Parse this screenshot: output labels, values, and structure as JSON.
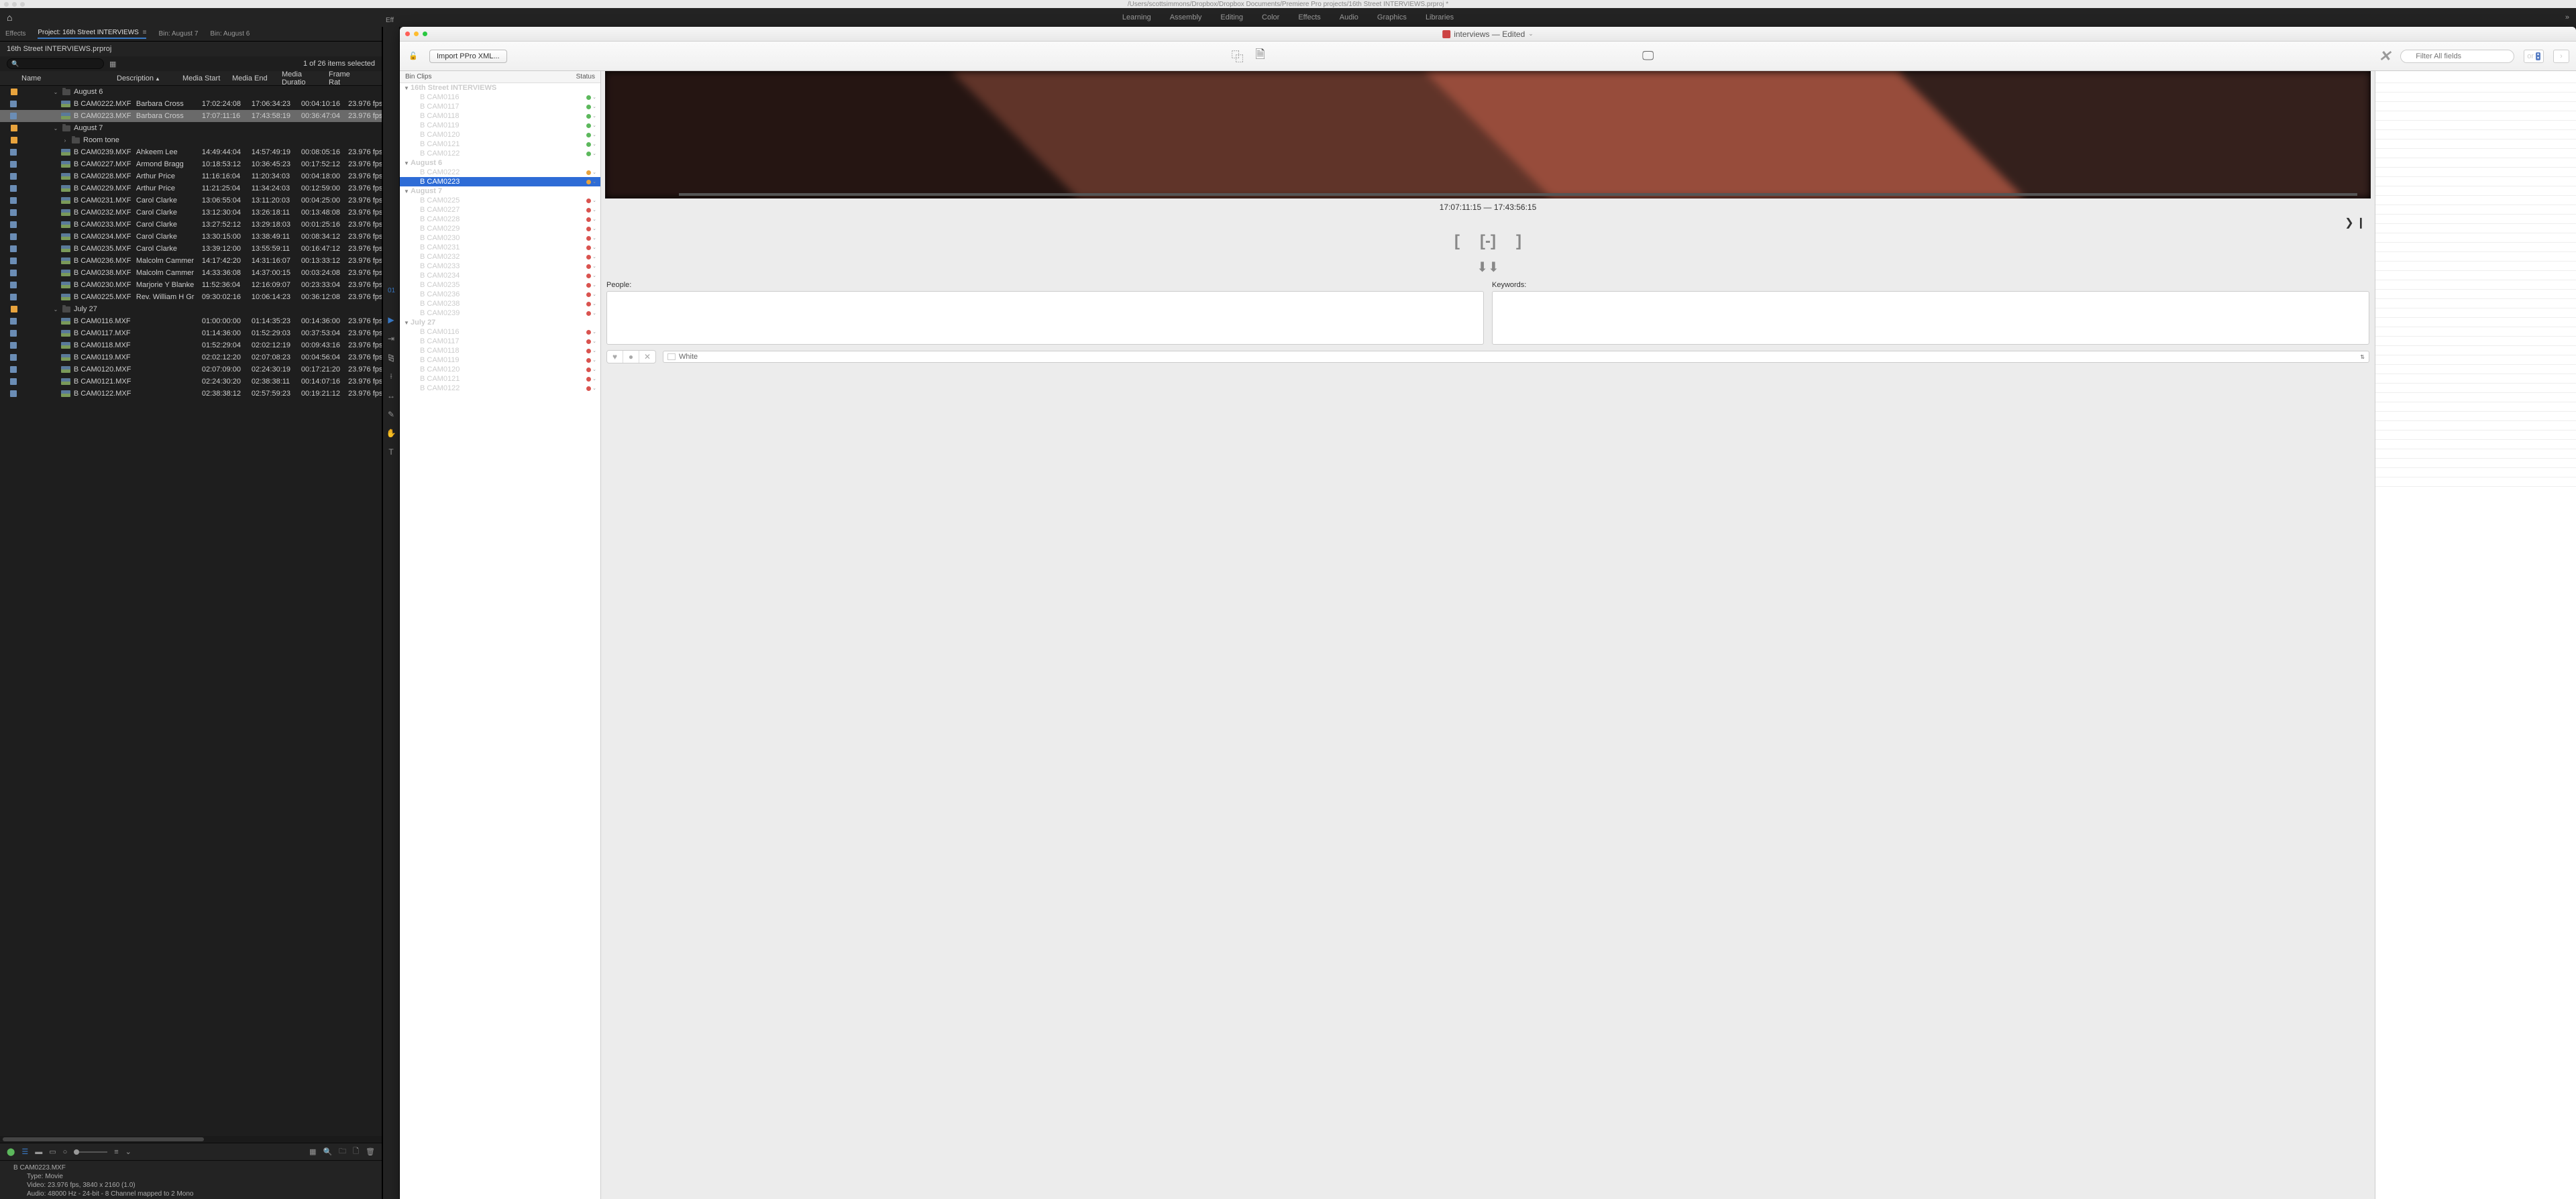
{
  "mac_title": "/Users/scottsimmons/Dropbox/Dropbox Documents/Premiere Pro projects/16th Street INTERVIEWS.prproj *",
  "workspaces": [
    "Learning",
    "Assembly",
    "Editing",
    "Color",
    "Effects",
    "Audio",
    "Graphics",
    "Libraries"
  ],
  "panel_tabs": {
    "effects": "Effects",
    "project": "Project: 16th Street INTERVIEWS",
    "bin1": "Bin: August 7",
    "bin2": "Bin: August 6"
  },
  "project_title": "16th Street INTERVIEWS.prproj",
  "item_count": "1 of 26 items selected",
  "columns": {
    "name": "Name",
    "desc": "Description",
    "start": "Media Start",
    "end": "Media End",
    "dur": "Media Duratio",
    "fps": "Frame Rat"
  },
  "folders": {
    "aug6": "August 6",
    "aug7": "August 7",
    "roomtone": "Room tone",
    "jul27": "July 27"
  },
  "rows": [
    {
      "g": "aug6",
      "name": "B CAM0222.MXF",
      "desc": "Barbara Cross",
      "start": "17:02:24:08",
      "end": "17:06:34:23",
      "dur": "00:04:10:16",
      "fps": "23.976 fps"
    },
    {
      "g": "aug6",
      "name": "B CAM0223.MXF",
      "desc": "Barbara Cross",
      "start": "17:07:11:16",
      "end": "17:43:58:19",
      "dur": "00:36:47:04",
      "fps": "23.976 fps",
      "sel": true
    },
    {
      "g": "aug7",
      "name": "B CAM0239.MXF",
      "desc": "Ahkeem Lee",
      "start": "14:49:44:04",
      "end": "14:57:49:19",
      "dur": "00:08:05:16",
      "fps": "23.976 fps"
    },
    {
      "g": "aug7",
      "name": "B CAM0227.MXF",
      "desc": "Armond Bragg",
      "start": "10:18:53:12",
      "end": "10:36:45:23",
      "dur": "00:17:52:12",
      "fps": "23.976 fps"
    },
    {
      "g": "aug7",
      "name": "B CAM0228.MXF",
      "desc": "Arthur Price",
      "start": "11:16:16:04",
      "end": "11:20:34:03",
      "dur": "00:04:18:00",
      "fps": "23.976 fps"
    },
    {
      "g": "aug7",
      "name": "B CAM0229.MXF",
      "desc": "Arthur Price",
      "start": "11:21:25:04",
      "end": "11:34:24:03",
      "dur": "00:12:59:00",
      "fps": "23.976 fps"
    },
    {
      "g": "aug7",
      "name": "B CAM0231.MXF",
      "desc": "Carol Clarke",
      "start": "13:06:55:04",
      "end": "13:11:20:03",
      "dur": "00:04:25:00",
      "fps": "23.976 fps"
    },
    {
      "g": "aug7",
      "name": "B CAM0232.MXF",
      "desc": "Carol Clarke",
      "start": "13:12:30:04",
      "end": "13:26:18:11",
      "dur": "00:13:48:08",
      "fps": "23.976 fps"
    },
    {
      "g": "aug7",
      "name": "B CAM0233.MXF",
      "desc": "Carol Clarke",
      "start": "13:27:52:12",
      "end": "13:29:18:03",
      "dur": "00:01:25:16",
      "fps": "23.976 fps"
    },
    {
      "g": "aug7",
      "name": "B CAM0234.MXF",
      "desc": "Carol Clarke",
      "start": "13:30:15:00",
      "end": "13:38:49:11",
      "dur": "00:08:34:12",
      "fps": "23.976 fps"
    },
    {
      "g": "aug7",
      "name": "B CAM0235.MXF",
      "desc": "Carol Clarke",
      "start": "13:39:12:00",
      "end": "13:55:59:11",
      "dur": "00:16:47:12",
      "fps": "23.976 fps"
    },
    {
      "g": "aug7",
      "name": "B CAM0236.MXF",
      "desc": "Malcolm Cammer",
      "start": "14:17:42:20",
      "end": "14:31:16:07",
      "dur": "00:13:33:12",
      "fps": "23.976 fps"
    },
    {
      "g": "aug7",
      "name": "B CAM0238.MXF",
      "desc": "Malcolm Cammer",
      "start": "14:33:36:08",
      "end": "14:37:00:15",
      "dur": "00:03:24:08",
      "fps": "23.976 fps"
    },
    {
      "g": "aug7",
      "name": "B CAM0230.MXF",
      "desc": "Marjorie Y Blanke",
      "start": "11:52:36:04",
      "end": "12:16:09:07",
      "dur": "00:23:33:04",
      "fps": "23.976 fps"
    },
    {
      "g": "aug7",
      "name": "B CAM0225.MXF",
      "desc": "Rev. William H Gr",
      "start": "09:30:02:16",
      "end": "10:06:14:23",
      "dur": "00:36:12:08",
      "fps": "23.976 fps"
    },
    {
      "g": "jul27",
      "name": "B CAM0116.MXF",
      "desc": "",
      "start": "01:00:00:00",
      "end": "01:14:35:23",
      "dur": "00:14:36:00",
      "fps": "23.976 fps"
    },
    {
      "g": "jul27",
      "name": "B CAM0117.MXF",
      "desc": "",
      "start": "01:14:36:00",
      "end": "01:52:29:03",
      "dur": "00:37:53:04",
      "fps": "23.976 fps"
    },
    {
      "g": "jul27",
      "name": "B CAM0118.MXF",
      "desc": "",
      "start": "01:52:29:04",
      "end": "02:02:12:19",
      "dur": "00:09:43:16",
      "fps": "23.976 fps"
    },
    {
      "g": "jul27",
      "name": "B CAM0119.MXF",
      "desc": "",
      "start": "02:02:12:20",
      "end": "02:07:08:23",
      "dur": "00:04:56:04",
      "fps": "23.976 fps"
    },
    {
      "g": "jul27",
      "name": "B CAM0120.MXF",
      "desc": "",
      "start": "02:07:09:00",
      "end": "02:24:30:19",
      "dur": "00:17:21:20",
      "fps": "23.976 fps"
    },
    {
      "g": "jul27",
      "name": "B CAM0121.MXF",
      "desc": "",
      "start": "02:24:30:20",
      "end": "02:38:38:11",
      "dur": "00:14:07:16",
      "fps": "23.976 fps"
    },
    {
      "g": "jul27",
      "name": "B CAM0122.MXF",
      "desc": "",
      "start": "02:38:38:12",
      "end": "02:57:59:23",
      "dur": "00:19:21:12",
      "fps": "23.976 fps"
    }
  ],
  "info": {
    "name": "B CAM0223.MXF",
    "type": "Type:  Movie",
    "video": "Video:  23.976 fps, 3840 x 2160 (1.0)",
    "audio": "Audio:  48000 Hz - 24-bit - 8 Channel mapped to 2 Mono"
  },
  "float": {
    "title": "interviews — Edited",
    "import_btn": "Import PPro XML...",
    "bin_header": "Bin Clips",
    "status_header": "Status",
    "filter_placeholder": "Filter All fields",
    "or_label": "or",
    "timecode": "17:07:11:15 — 17:43:56:15",
    "people_label": "People:",
    "keywords_label": "Keywords:",
    "color_label": "White",
    "tree": [
      {
        "label": "16th Street INTERVIEWS",
        "depth": 0,
        "bold": true,
        "twirl": true
      },
      {
        "label": "B CAM0116",
        "depth": 1,
        "status": "green"
      },
      {
        "label": "B CAM0117",
        "depth": 1,
        "status": "green"
      },
      {
        "label": "B CAM0118",
        "depth": 1,
        "status": "green"
      },
      {
        "label": "B CAM0119",
        "depth": 1,
        "status": "green"
      },
      {
        "label": "B CAM0120",
        "depth": 1,
        "status": "green"
      },
      {
        "label": "B CAM0121",
        "depth": 1,
        "status": "green"
      },
      {
        "label": "B CAM0122",
        "depth": 1,
        "status": "green"
      },
      {
        "label": "August 6",
        "depth": 0,
        "bold": true,
        "twirl": true
      },
      {
        "label": "B CAM0222",
        "depth": 1,
        "status": "yellow"
      },
      {
        "label": "B CAM0223",
        "depth": 1,
        "status": "yellow",
        "sel": true
      },
      {
        "label": "August 7",
        "depth": 0,
        "bold": true,
        "twirl": true
      },
      {
        "label": "B CAM0225",
        "depth": 1,
        "status": "red"
      },
      {
        "label": "B CAM0227",
        "depth": 1,
        "status": "red"
      },
      {
        "label": "B CAM0228",
        "depth": 1,
        "status": "red"
      },
      {
        "label": "B CAM0229",
        "depth": 1,
        "status": "red"
      },
      {
        "label": "B CAM0230",
        "depth": 1,
        "status": "red"
      },
      {
        "label": "B CAM0231",
        "depth": 1,
        "status": "red"
      },
      {
        "label": "B CAM0232",
        "depth": 1,
        "status": "red"
      },
      {
        "label": "B CAM0233",
        "depth": 1,
        "status": "red"
      },
      {
        "label": "B CAM0234",
        "depth": 1,
        "status": "red"
      },
      {
        "label": "B CAM0235",
        "depth": 1,
        "status": "red"
      },
      {
        "label": "B CAM0236",
        "depth": 1,
        "status": "red"
      },
      {
        "label": "B CAM0238",
        "depth": 1,
        "status": "red"
      },
      {
        "label": "B CAM0239",
        "depth": 1,
        "status": "red"
      },
      {
        "label": "July 27",
        "depth": 0,
        "bold": true,
        "twirl": true
      },
      {
        "label": "B CAM0116",
        "depth": 1,
        "status": "red"
      },
      {
        "label": "B CAM0117",
        "depth": 1,
        "status": "red"
      },
      {
        "label": "B CAM0118",
        "depth": 1,
        "status": "red"
      },
      {
        "label": "B CAM0119",
        "depth": 1,
        "status": "red"
      },
      {
        "label": "B CAM0120",
        "depth": 1,
        "status": "red"
      },
      {
        "label": "B CAM0121",
        "depth": 1,
        "status": "red"
      },
      {
        "label": "B CAM0122",
        "depth": 1,
        "status": "red"
      }
    ]
  },
  "eff_label": "Eff",
  "tc_label": "01"
}
